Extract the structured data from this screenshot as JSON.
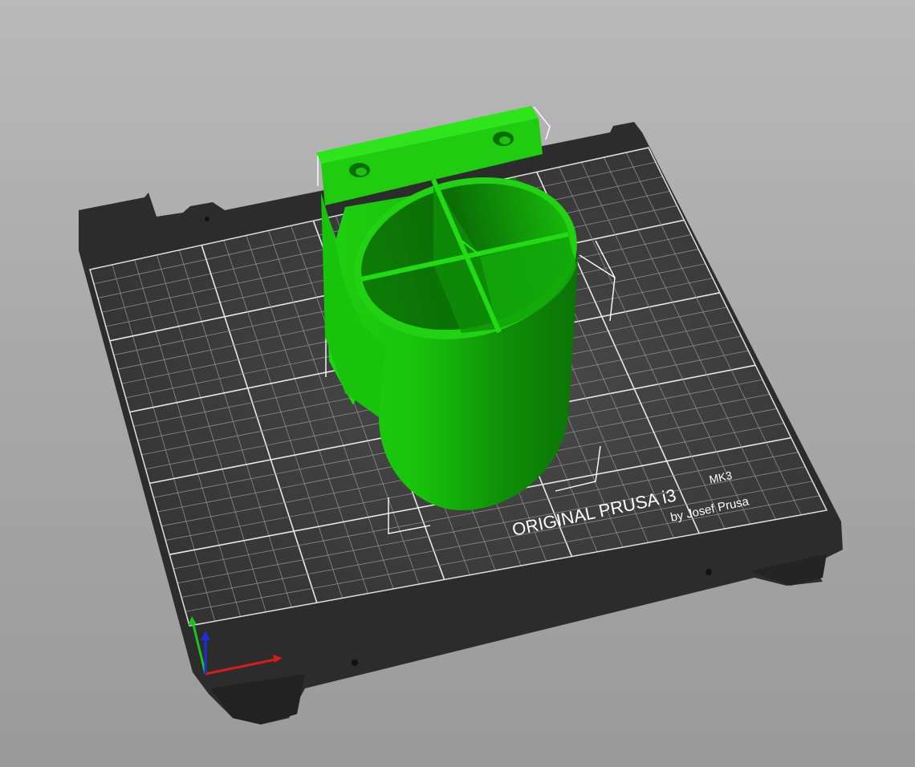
{
  "app": "PrusaSlicer 3D view",
  "bed": {
    "model_line1": "ORIGINAL PRUSA i3",
    "model_suffix": "MK3",
    "maker_line": "by Josef Prusa"
  },
  "colors": {
    "background_top": "#b9b9b9",
    "background_bottom": "#9a9a9a",
    "bed_dark": "#2b2b2b",
    "bed_surface": "#3a3a3a",
    "grid_major": "#e8e8e8",
    "grid_minor": "#8c8c8c",
    "object_light": "#22dd11",
    "object_mid": "#14b80a",
    "object_dark": "#0a7a05",
    "axis_x": "#d81b1b",
    "axis_y": "#1fbf1f",
    "axis_z": "#1a2fd6"
  },
  "object": {
    "name": "cup-holder",
    "compartments": 4,
    "mount_holes": 2
  },
  "axes": [
    "x",
    "y",
    "z"
  ]
}
